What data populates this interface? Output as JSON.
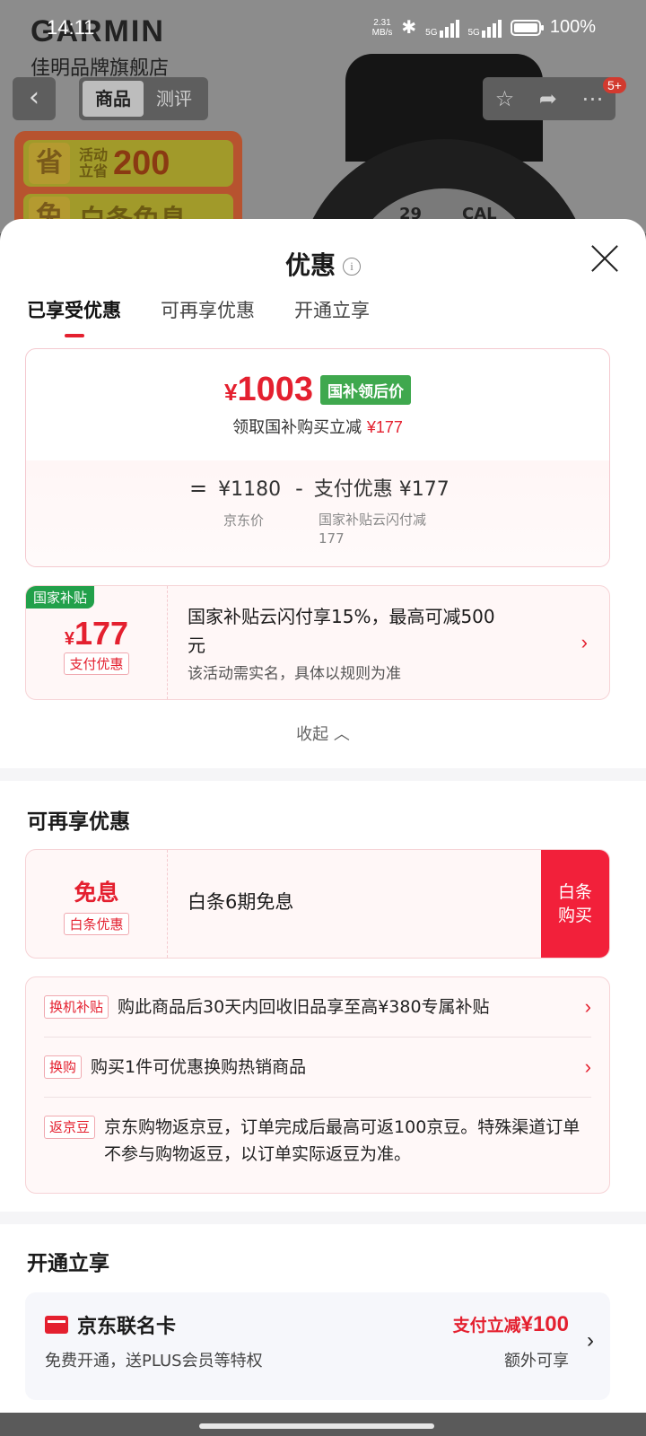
{
  "status_bar": {
    "time": "14:11",
    "net_speed_value": "2.31",
    "net_speed_unit": "MB/s",
    "signal1": "5G",
    "signal2": "5G",
    "battery": "100%"
  },
  "background": {
    "brand": "GARMIN",
    "shop_name": "佳明品牌旗舰店",
    "tabs": [
      "商品",
      "测评"
    ],
    "badge": "5+",
    "promo": {
      "save_char": "省",
      "activity_line1": "活动",
      "activity_line2": "立省",
      "save_amount": "200",
      "free_char": "免",
      "free_text": "白条免息"
    },
    "watch_text_left": "29",
    "watch_text_right": "CAL"
  },
  "sheet": {
    "title": "优惠",
    "tabs": [
      "已享受优惠",
      "可再享优惠",
      "开通立享"
    ],
    "price_card": {
      "price": "1003",
      "currency": "¥",
      "tag": "国补领后价",
      "subtitle": "领取国补购买立减",
      "subtitle_amount": "¥177",
      "eq": "=",
      "jd_price": "¥1180",
      "minus": "-",
      "pay_discount": "支付优惠 ¥177",
      "jd_price_label": "京东价",
      "pay_label_line1": "国家补贴云闪付减",
      "pay_label_line2": "177"
    },
    "subsidy_card": {
      "corner": "国家补贴",
      "amount": "177",
      "currency": "¥",
      "label": "支付优惠",
      "text_line1": "国家补贴云闪付享15%，最高可减500",
      "text_line2": "元",
      "note": "该活动需实名，具体以规则为准"
    },
    "collapse": "收起",
    "more_title": "可再享优惠",
    "interest": {
      "name": "免息",
      "label": "白条优惠",
      "text": "白条6期免息",
      "button_line1": "白条",
      "button_line2": "购买"
    },
    "benefits": [
      {
        "tag": "换机补贴",
        "text": "购此商品后30天内回收旧品享至高¥380专属补贴"
      },
      {
        "tag": "换购",
        "text": "购买1件可优惠换购热销商品"
      },
      {
        "tag": "返京豆",
        "text": "京东购物返京豆，订单完成后最高可返100京豆。特殊渠道订单不参与购物返豆，以订单实际返豆为准。"
      }
    ],
    "open_title": "开通立享",
    "card": {
      "name": "京东联名卡",
      "desc": "免费开通，送PLUS会员等特权",
      "offer_prefix": "支付立减",
      "offer_amount": "¥100",
      "extra": "额外可享"
    }
  }
}
